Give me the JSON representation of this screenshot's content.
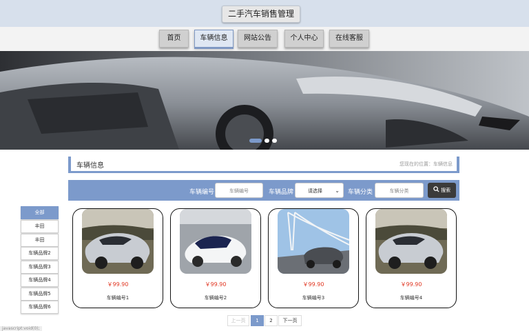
{
  "site_title": "二手汽车销售管理",
  "nav": [
    "首页",
    "车辆信息",
    "网站公告",
    "个人中心",
    "在线客服"
  ],
  "nav_active": 1,
  "banner": {
    "slides": 3,
    "active_slide": 0
  },
  "crumb": {
    "title": "车辆信息",
    "location": "您现在的位置：车辆信息"
  },
  "filter": {
    "label1": "车辆编号",
    "placeholder1": "车辆编号",
    "label2": "车辆品牌",
    "select_value": "请选择",
    "label3": "车辆分类",
    "placeholder3": "车辆分类",
    "search_label": "搜索"
  },
  "categories": [
    "全部",
    "丰田",
    "丰田",
    "车辆品牌2",
    "车辆品牌3",
    "车辆品牌4",
    "车辆品牌5",
    "车辆品牌6"
  ],
  "products": [
    {
      "price": "￥99.90",
      "name": "车辆编号1"
    },
    {
      "price": "￥99.90",
      "name": "车辆编号2"
    },
    {
      "price": "￥99.90",
      "name": "车辆编号3"
    },
    {
      "price": "￥99.90",
      "name": "车辆编号4"
    }
  ],
  "pagination": {
    "prev": "上一页",
    "pages": [
      "1",
      "2"
    ],
    "next": "下一页"
  },
  "status_text": "javascript:void(0);",
  "colors": {
    "accent": "#7c9acb",
    "price": "#e0341f",
    "header_bg": "#d7e0ec"
  }
}
